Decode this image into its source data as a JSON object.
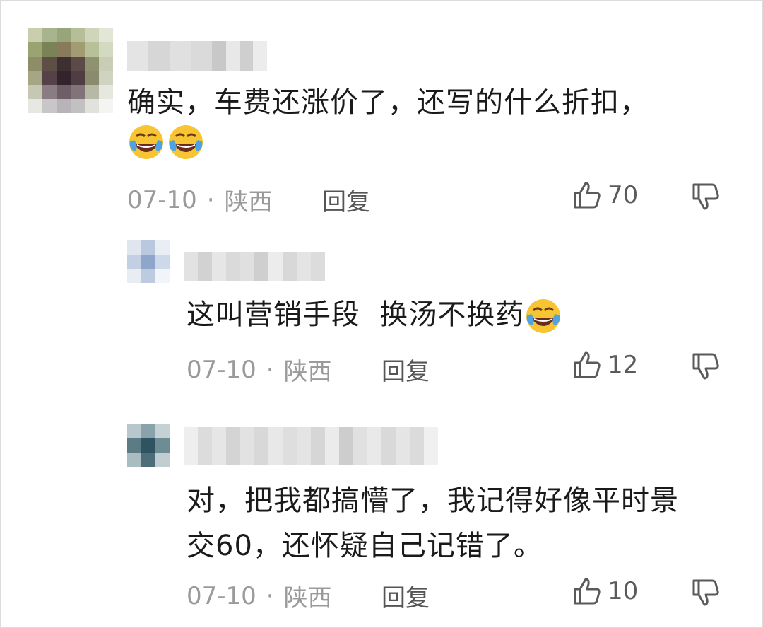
{
  "comments": [
    {
      "text": "确实，车费还涨价了，还写的什么折扣，",
      "emoji_icon": "laughing-crying-icon",
      "date": "07-10",
      "location": "陕西",
      "reply_label": "回复",
      "likes": "70"
    },
    {
      "text": "这叫营销手段  换汤不换药",
      "emoji_icon": "laughing-crying-icon",
      "date": "07-10",
      "location": "陕西",
      "reply_label": "回复",
      "likes": "12"
    },
    {
      "text_line1": "对，把我都搞懵了，我记得好像平时景",
      "text_line2": "交60，还怀疑自己记错了。",
      "date": "07-10",
      "location": "陕西",
      "reply_label": "回复",
      "likes": "10"
    }
  ],
  "colors": {
    "meta": "#9a9a9a",
    "text": "#1a1a1a",
    "emoji_face": "#f7c531"
  }
}
